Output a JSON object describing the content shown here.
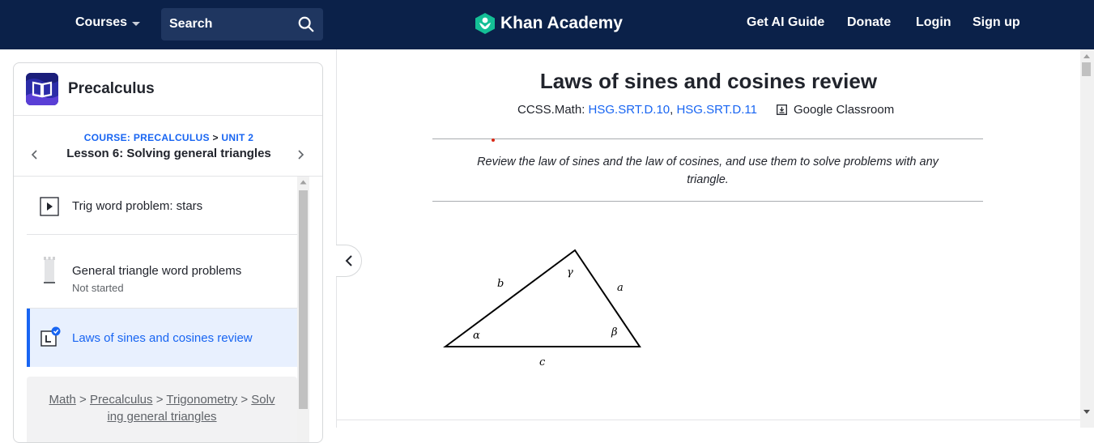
{
  "nav": {
    "courses": "Courses",
    "search_placeholder": "Search",
    "brand": "Khan Academy",
    "links": [
      "Get AI Guide",
      "Donate",
      "Login",
      "Sign up"
    ]
  },
  "sidebar": {
    "course_title": "Precalculus",
    "course_label": "COURSE: PRECALCULUS",
    "unit_sep": ">",
    "unit_label": "UNIT 2",
    "lesson_title": "Lesson 6: Solving general triangles",
    "items": [
      {
        "label": "Trig word problem: stars",
        "status": ""
      },
      {
        "label": "General triangle word problems",
        "status": "Not started"
      },
      {
        "label": "Laws of sines and cosines review",
        "status": ""
      }
    ],
    "breadcrumb": [
      "Math",
      "Precalculus",
      "Trigonometry",
      "Solving general triangles"
    ],
    "breadcrumb_lines": [
      "Solv",
      "ing general triangles"
    ]
  },
  "article": {
    "title": "Laws of sines and cosines review",
    "standards_prefix": "CCSS.Math:",
    "standards": [
      "HSG.SRT.D.10",
      "HSG.SRT.D.11"
    ],
    "classroom": "Google Classroom",
    "intro": "Review the law of sines and the law of cosines, and use them to solve problems with any triangle.",
    "triangle_labels": {
      "side_a": "a",
      "side_b": "b",
      "side_c": "c",
      "alpha": "α",
      "beta": "β",
      "gamma": "γ"
    }
  },
  "colors": {
    "nav_bg": "#0b2149",
    "link": "#1865f2",
    "active_bg": "#e8f0fe",
    "brand_green": "#14bf96"
  }
}
